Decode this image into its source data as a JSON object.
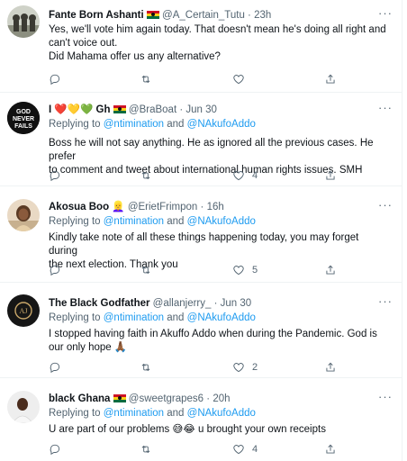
{
  "colors": {
    "link": "#1d9bf0",
    "secondary": "#536471",
    "text": "#0f1419",
    "border": "#eff3f4"
  },
  "icons": {
    "reply": "speech-bubble-icon",
    "retweet": "retweet-icon",
    "like": "heart-icon",
    "share": "share-icon",
    "more": "more-dots-icon"
  },
  "tweets": [
    {
      "name": "Fante Born Ashanti",
      "handle": "@A_Certain_Tutu",
      "sep": "·",
      "time": "23h",
      "replying": "",
      "text": [
        "Yes, we'll vote him again today. That doesn't mean he's doing all right and",
        "can't voice out.",
        "Did Mahama offer us any alternative?"
      ],
      "reply_count": "",
      "retweet_count": "",
      "like_count": ""
    },
    {
      "name": "I ❤️💛💚 Gh",
      "handle": "@BraBoat",
      "sep": "·",
      "time": "Jun 30",
      "replying_prefix": "Replying to",
      "mentions": [
        "@ntimination",
        "@NAkufoAddo"
      ],
      "and": "and",
      "text": [
        "Boss he will not say anything. He as ignored all the previous cases. He prefer",
        "to comment  and tweet about international human rights issues. SMH"
      ],
      "reply_count": "",
      "retweet_count": "",
      "like_count": "4"
    },
    {
      "name": "Akosua Boo",
      "handle": "@ErietFrimpon",
      "sep": "·",
      "time": "16h",
      "replying_prefix": "Replying to",
      "mentions": [
        "@ntimination",
        "@NAkufoAddo"
      ],
      "and": "and",
      "text": [
        "Kindly take note of all these things happening today, you may forget during",
        "the next election. Thank you"
      ],
      "reply_count": "",
      "retweet_count": "",
      "like_count": "5"
    },
    {
      "name": "The Black Godfather",
      "handle": "@allanjerry_",
      "sep": "·",
      "time": "Jun 30",
      "replying_prefix": "Replying to",
      "mentions": [
        "@ntimination",
        "@NAkufoAddo"
      ],
      "and": "and",
      "text": [
        "I stopped having faith in Akuffo Addo when during the Pandemic. God is",
        "our only hope 🙏🏾"
      ],
      "reply_count": "",
      "retweet_count": "",
      "like_count": "2"
    },
    {
      "name": "black Ghana",
      "handle": "@sweetgrapes6",
      "sep": "·",
      "time": "20h",
      "replying_prefix": "Replying to",
      "mentions": [
        "@ntimination",
        "@NAkufoAddo"
      ],
      "and": "and",
      "text": [
        "U are part of our problems 😅😂 u brought your own receipts"
      ],
      "reply_count": "",
      "retweet_count": "",
      "like_count": "4"
    }
  ],
  "avatar2_text": [
    "GOD",
    "NEVER",
    "FAILS"
  ]
}
